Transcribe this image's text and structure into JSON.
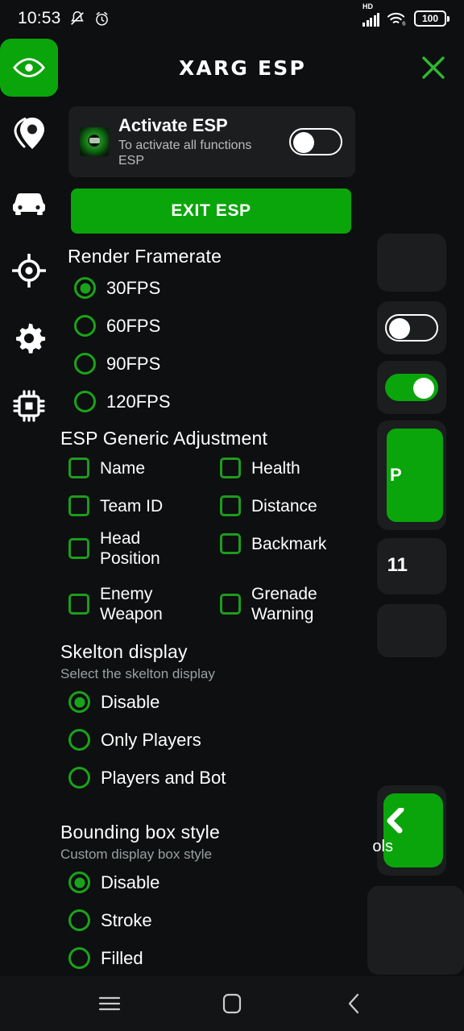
{
  "status_bar": {
    "time": "10:53",
    "icons_left": [
      "mute-bell-icon",
      "alarm-clock-icon"
    ],
    "icons_right": [
      "hd-signal-icon",
      "wifi6-icon",
      "battery-icon"
    ],
    "battery_level": "100",
    "network_label": "HD",
    "wifi_label": "6"
  },
  "header": {
    "title": "XARG ESP",
    "close_label": "×",
    "logo_icon": "eye-icon",
    "close_icon": "close-x-icon"
  },
  "sidebar": {
    "items": [
      {
        "icon": "eye-icon",
        "name": "esp",
        "active": true
      },
      {
        "icon": "location-pin-icon",
        "name": "location",
        "active": false
      },
      {
        "icon": "car-icon",
        "name": "vehicle",
        "active": false
      },
      {
        "icon": "crosshair-target-icon",
        "name": "aim",
        "active": false
      },
      {
        "icon": "gear-icon",
        "name": "settings",
        "active": false
      },
      {
        "icon": "cpu-chip-icon",
        "name": "memory",
        "active": false
      }
    ]
  },
  "activate_card": {
    "title": "Activate ESP",
    "subtitle": "To activate all functions ESP",
    "toggle_state": "off",
    "thumb_icon": "app-logo-thumbnail"
  },
  "exit_button": {
    "label": "EXIT ESP"
  },
  "sections": {
    "render_framerate": {
      "title": "Render Framerate",
      "options": [
        {
          "label": "30FPS",
          "selected": true
        },
        {
          "label": "60FPS",
          "selected": false
        },
        {
          "label": "90FPS",
          "selected": false
        },
        {
          "label": "120FPS",
          "selected": false
        }
      ]
    },
    "esp_generic_adjustment": {
      "title": "ESP Generic Adjustment",
      "options_left": [
        {
          "label": "Name",
          "checked": false
        },
        {
          "label": "Team ID",
          "checked": false
        },
        {
          "label": "Head Position",
          "checked": false
        },
        {
          "label": "Enemy Weapon",
          "checked": false
        }
      ],
      "options_right": [
        {
          "label": "Health",
          "checked": false
        },
        {
          "label": "Distance",
          "checked": false
        },
        {
          "label": "Backmark",
          "checked": false
        },
        {
          "label": "Grenade Warning",
          "checked": false
        }
      ]
    },
    "skelton_display": {
      "title": "Skelton display",
      "subtitle": "Select the skelton display",
      "options": [
        {
          "label": "Disable",
          "selected": true
        },
        {
          "label": "Only Players",
          "selected": false
        },
        {
          "label": "Players and Bot",
          "selected": false
        }
      ]
    },
    "bounding_box_style": {
      "title": "Bounding box style",
      "subtitle": "Custom display box style",
      "options": [
        {
          "label": "Disable",
          "selected": true
        },
        {
          "label": "Stroke",
          "selected": false
        },
        {
          "label": "Filled",
          "selected": false
        }
      ]
    }
  },
  "background_app": {
    "partial_texts": [
      "P",
      "11",
      "ols"
    ],
    "toggles": [
      {
        "state": "off"
      },
      {
        "state": "on"
      }
    ]
  },
  "navbar": {
    "items": [
      {
        "icon": "menu-recents-icon",
        "name": "recents"
      },
      {
        "icon": "home-square-icon",
        "name": "home"
      },
      {
        "icon": "back-chevron-icon",
        "name": "back"
      }
    ]
  },
  "colors": {
    "accent_green": "#0AA50A",
    "radio_green": "#1AA31A",
    "background": "#0D0F10",
    "card": "#1B1D1F",
    "text_primary": "#FFFFFF",
    "text_secondary": "#9AA0A3"
  }
}
